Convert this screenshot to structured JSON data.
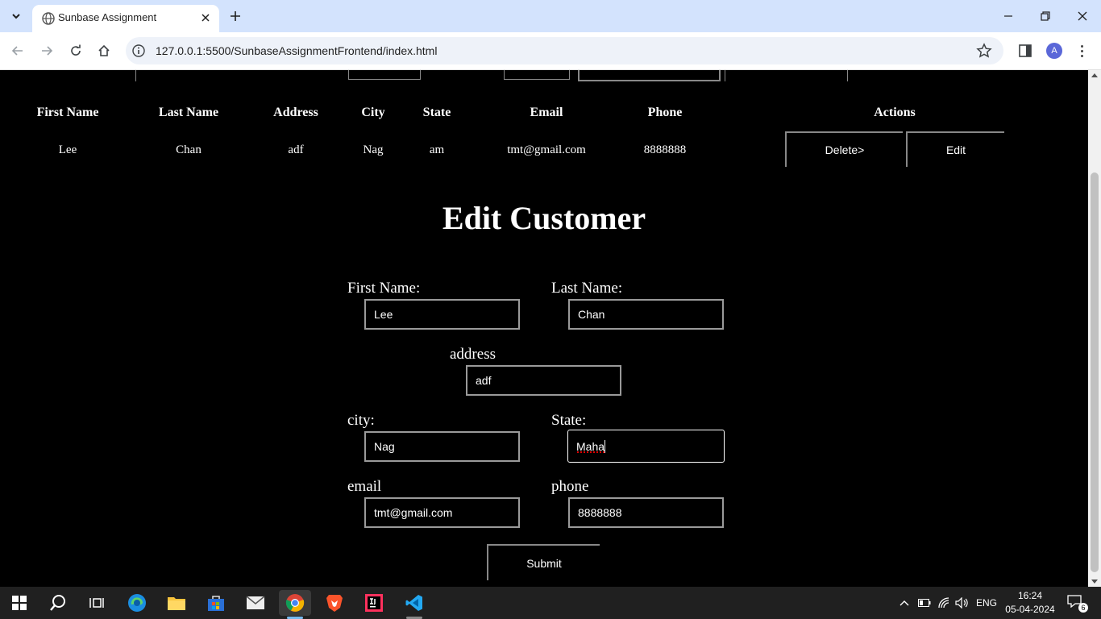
{
  "browser": {
    "tab_title": "Sunbase Assignment",
    "url": "127.0.0.1:5500/SunbaseAssignmentFrontend/index.html",
    "profile_initial": "A"
  },
  "table": {
    "headers": [
      "First Name",
      "Last Name",
      "Address",
      "City",
      "State",
      "Email",
      "Phone",
      "Actions"
    ],
    "rows": [
      {
        "first_name": "Lee",
        "last_name": "Chan",
        "address": "adf",
        "city": "Nag",
        "state": "am",
        "email": "tmt@gmail.com",
        "phone": "8888888",
        "delete_label": "Delete>",
        "edit_label": "Edit"
      }
    ]
  },
  "form": {
    "title": "Edit Customer",
    "first_name_label": "First Name:",
    "first_name_value": "Lee",
    "last_name_label": "Last Name:",
    "last_name_value": "Chan",
    "address_label": "address",
    "address_value": "adf",
    "city_label": "city:",
    "city_value": "Nag",
    "state_label": "State:",
    "state_value": "Maha",
    "email_label": "email",
    "email_value": "tmt@gmail.com",
    "phone_label": "phone",
    "phone_value": "8888888",
    "submit_label": "Submit"
  },
  "taskbar": {
    "language": "ENG",
    "time": "16:24",
    "date": "05-04-2024",
    "notification_count": "6"
  },
  "colors": {
    "page_background": "#000000",
    "tabbar": "#d3e3fd",
    "omnibox": "#eef2f9",
    "taskbar": "#202020",
    "accent": "#76b9ed"
  }
}
